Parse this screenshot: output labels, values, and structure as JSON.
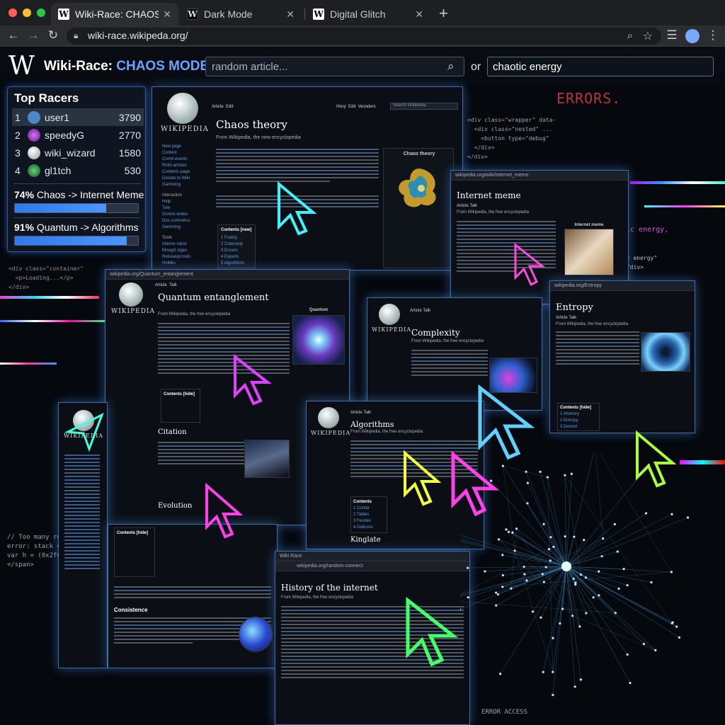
{
  "browser": {
    "tabs": [
      {
        "favicon": "W",
        "title": "Wiki-Race: CHAOS MODE",
        "active": true
      },
      {
        "favicon": "W",
        "title": "Dark Mode",
        "active": false
      },
      {
        "favicon": "W",
        "title": "Digital Glitch",
        "active": false
      }
    ],
    "url": "wiki-race.wikipeda.org/",
    "icons": [
      "back-arrow-icon",
      "forward-arrow-icon",
      "reload-icon",
      "lock-icon",
      "zoom-icon",
      "star-icon",
      "reading-list-icon",
      "profile-icon",
      "menu-icon"
    ]
  },
  "header": {
    "logo": "W",
    "title_prefix": "Wiki-Race: ",
    "title_mode": "CHAOS MODE",
    "search_placeholder": "random article...",
    "or_label": "or",
    "target_value": "chaotic energy"
  },
  "leaderboard": {
    "title": "Top Racers",
    "racers": [
      {
        "rank": "1",
        "name": "user1",
        "score": "3790",
        "avatar_color": "#4a86c8"
      },
      {
        "rank": "2",
        "name": "speedyG",
        "score": "2770",
        "avatar_color": "#b040d0"
      },
      {
        "rank": "3",
        "name": "wiki_wizard",
        "score": "1580",
        "avatar_color": "#d8d8d8"
      },
      {
        "rank": "4",
        "name": "gl1tch",
        "score": "530",
        "avatar_color": "#2d8a4a"
      }
    ],
    "races": [
      {
        "percent_label": "74%",
        "route": " Chaos -> Internet Meme",
        "progress": 0.74
      },
      {
        "percent_label": "91%",
        "route": " Quantum -> Algorithms",
        "progress": 0.91
      }
    ]
  },
  "backdrop": {
    "errors_text": "ERRORS.",
    "code_lines": [
      "<div class=\"wrapper\" data-",
      "  <div class=\"nested\" ...",
      "    <button type=\"debug\"",
      "  </div>",
      "</div>",
      "tic energy,",
      "ic energy\"",
      "</div>",
      "<div class=\"container\"",
      "  <p>Loading...</p>",
      "// Too many redirects",
      "error: stack overflow",
      "var h = (0x2f0);",
      "</span>",
      "ERROR ACCESS"
    ]
  },
  "windows": [
    {
      "id": "chaos",
      "title": "Chaos theory",
      "from": "From Wikipedia, the new encyclopedia",
      "tabs": [
        "Article",
        "Edit"
      ],
      "tools": [
        "Hisry",
        "Edit",
        "Vesnders"
      ],
      "search": "Search Wikipedia",
      "infobox_title": "Chaos theory",
      "contents_title": "Contents [new]",
      "contents": [
        "1 Fuskry",
        "2 Coterouty",
        "3 Encers",
        "4 Experts",
        "5 Algorithms"
      ],
      "sidebar": [
        "New page",
        "Contest",
        "Cnrmt events",
        "Rnlm articles",
        "Contents page",
        "Donate to Wiki",
        "Gamming",
        "Interaction",
        "Help",
        "Tole",
        "Donnis tedies",
        "Dos connnetss",
        "Gemming",
        "Tools",
        "Interne ndice",
        "Mnegzl stges",
        "Reloaasprnnds",
        "Hnllilks"
      ]
    },
    {
      "id": "meme",
      "title": "Internet meme",
      "from": "From Wikipedia, the free encyclopedia",
      "tabs": [
        "Article",
        "Talk"
      ],
      "caption": "Internet meme",
      "bar": "wikipedia.org/wiki/Internet_meme"
    },
    {
      "id": "quantum",
      "title": "Quantum entanglement",
      "from": "From Wikipedia, the free encyclopedia",
      "tabs": [
        "Article",
        "Talk"
      ],
      "caption": "Quantum",
      "subhead": "Citation",
      "subhead2": "Evolution",
      "contents_title": "Contents [hide]",
      "bar": "wikipedia.org/Quantum_entanglement"
    },
    {
      "id": "complexity",
      "title": "Complexity",
      "from": "From Wikipedia, the free encyclopedia",
      "tabs": [
        "Article",
        "Talk"
      ]
    },
    {
      "id": "entropy",
      "title": "Entropy",
      "from": "From Wikipedia, the free encyclopedia",
      "tabs": [
        "Article",
        "Talk"
      ],
      "contents_title": "Contents [hide]",
      "contents": [
        "1 Histnory",
        "2 Entropy",
        "3 Denmrt",
        "4 Mathemat"
      ],
      "bar": "wikipedia.org/Entropy"
    },
    {
      "id": "algorithms",
      "title": "Algorithms",
      "from": "From Wikipedia, the free encyclopedia",
      "tabs": [
        "Article",
        "Talk"
      ],
      "subhead": "Kinglate",
      "contents_title": "Contents",
      "contents": [
        "1 Contar",
        "2 Tables",
        "3 Fendeir",
        "4 Delicons",
        "5 Algorithms"
      ]
    },
    {
      "id": "history",
      "title": "History of the internet",
      "from": "From Wikipedia, the free encyclopedia",
      "bar_tab": "Wiki Race",
      "bar_url": "wikipedia.org/random-connect"
    },
    {
      "id": "small",
      "contents_title": "Contents [hide]",
      "subhead": "Consistence",
      "wordmark": "WIKIPEDIA"
    }
  ]
}
